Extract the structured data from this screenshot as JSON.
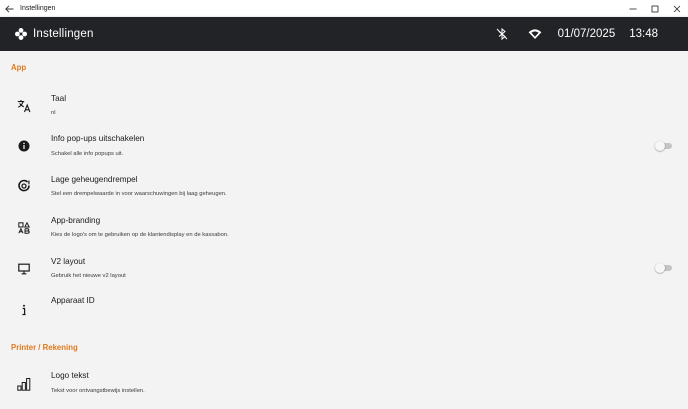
{
  "window": {
    "title": "Instellingen"
  },
  "appbar": {
    "title": "Instellingen",
    "date": "01/07/2025",
    "time": "13:48"
  },
  "sections": [
    {
      "title": "App"
    },
    {
      "title": "Printer / Rekening"
    }
  ],
  "rows": [
    {
      "title": "Taal",
      "subtitle": "nl",
      "icon": "translate-icon",
      "toggle": null
    },
    {
      "title": "Info pop-ups uitschakelen",
      "subtitle": "Schakel alle info popups uit.",
      "icon": "info-icon",
      "toggle": false
    },
    {
      "title": "Lage geheugendrempel",
      "subtitle": "Stel een drempelwaarde in voor waarschuwingen bij laag geheugen.",
      "icon": "memory-alert-icon",
      "toggle": null
    },
    {
      "title": "App-branding",
      "subtitle": "Kies de logo's om te gebruiken op de klantendisplay en de kassabon.",
      "icon": "branding-icon",
      "toggle": null
    },
    {
      "title": "V2 layout",
      "subtitle": "Gebruik het nieuwe v2 layout",
      "icon": "monitor-icon",
      "toggle": false
    },
    {
      "title": "Apparaat ID",
      "subtitle": "",
      "icon": "info-letter-icon",
      "toggle": null
    },
    {
      "title": "Logo tekst",
      "subtitle": "Tekst voor ontvangstbewijs instellen.",
      "icon": "signal-bars-icon",
      "toggle": null
    }
  ],
  "colors": {
    "accent": "#e07a1d",
    "appbar": "#212327",
    "background": "#f3f3f3"
  }
}
